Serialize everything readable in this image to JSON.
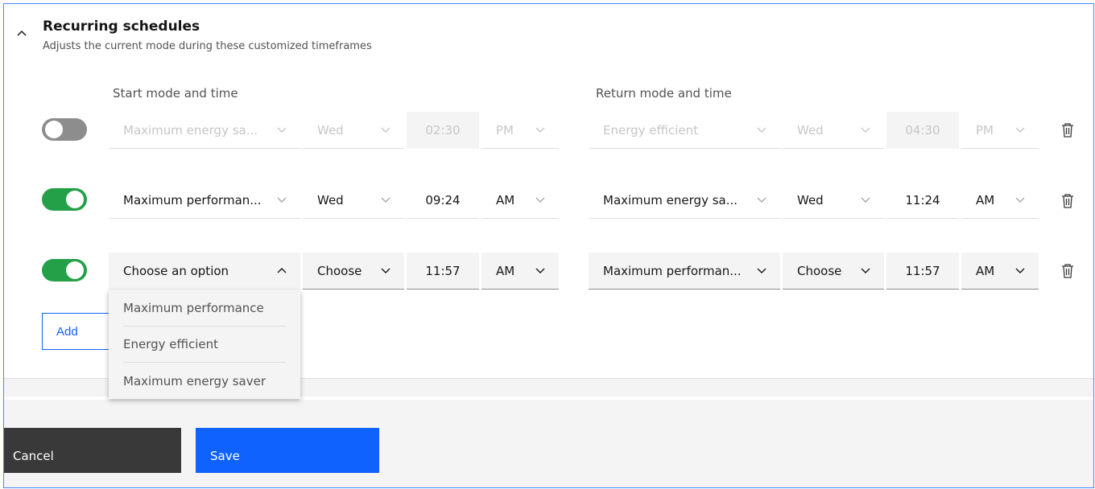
{
  "section": {
    "title": "Recurring schedules",
    "subtitle": "Adjusts the current mode during these customized timeframes"
  },
  "columns": {
    "start_label": "Start mode and time",
    "return_label": "Return mode and time"
  },
  "rows": [
    {
      "enabled": false,
      "start": {
        "mode": "Maximum energy sa...",
        "day": "Wed",
        "time": "02:30",
        "ampm": "PM"
      },
      "return": {
        "mode": "Energy efficient",
        "day": "Wed",
        "time": "04:30",
        "ampm": "PM"
      }
    },
    {
      "enabled": true,
      "start": {
        "mode": "Maximum performan...",
        "day": "Wed",
        "time": "09:24",
        "ampm": "AM"
      },
      "return": {
        "mode": "Maximum energy sa...",
        "day": "Wed",
        "time": "11:24",
        "ampm": "AM"
      }
    },
    {
      "enabled": true,
      "start": {
        "mode": "Choose an option",
        "day": "Choose",
        "time": "11:57",
        "ampm": "AM"
      },
      "return": {
        "mode": "Maximum performan...",
        "day": "Choose",
        "time": "11:57",
        "ampm": "AM"
      }
    }
  ],
  "dropdown_options": [
    "Maximum performance",
    "Energy efficient",
    "Maximum energy saver"
  ],
  "add_label": "Add",
  "footer": {
    "cancel_label": "Cancel",
    "save_label": "Save"
  },
  "colors": {
    "toggle_on": "#24a148",
    "toggle_off": "#8d8d8d",
    "primary": "#0f62fe",
    "secondary": "#393939"
  },
  "icons": {
    "collapse": "chevron-up-icon",
    "select": "chevron-down-icon",
    "delete": "trash-icon"
  }
}
